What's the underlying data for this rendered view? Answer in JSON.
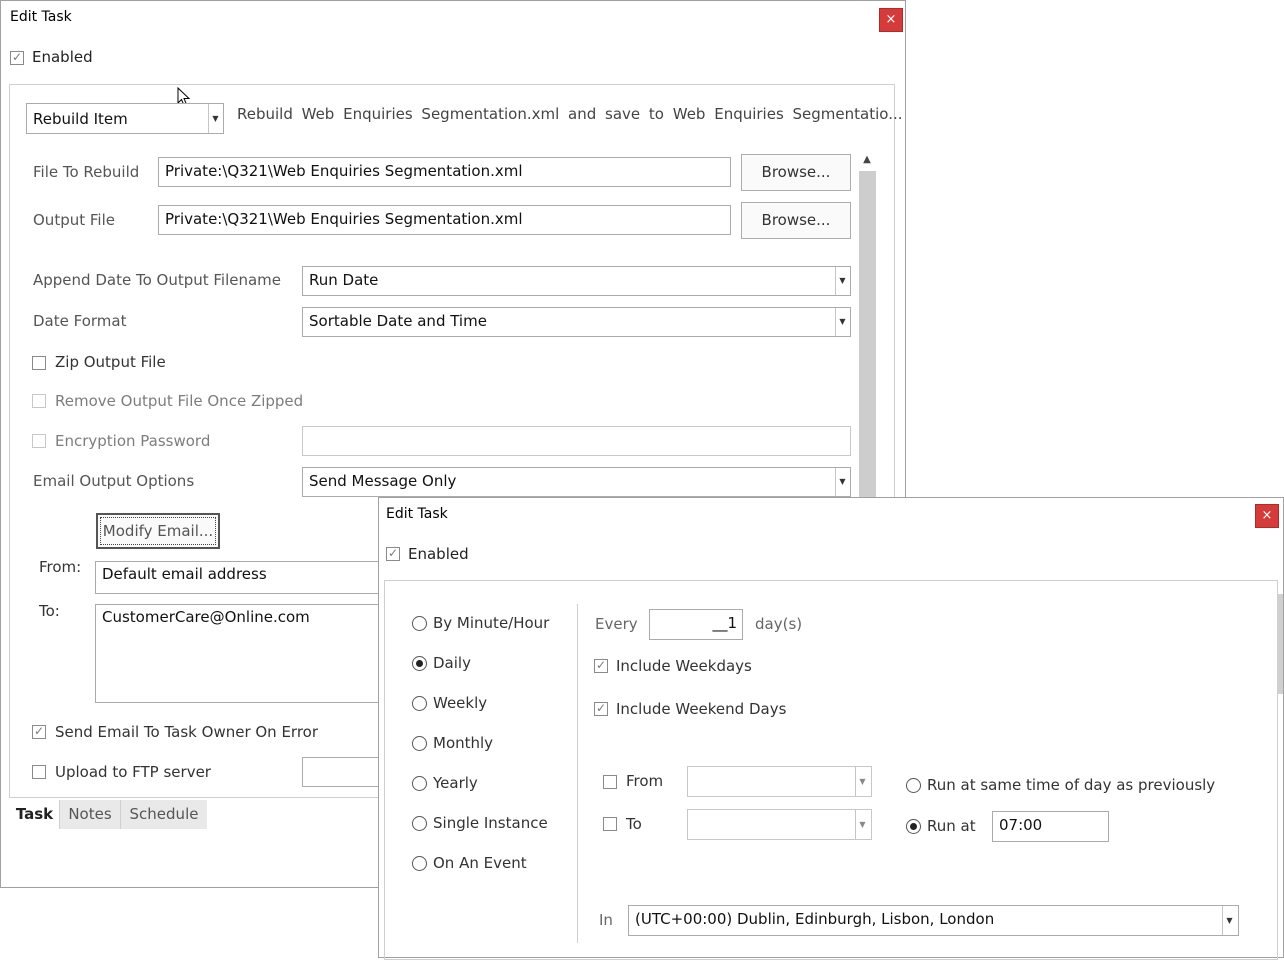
{
  "win1": {
    "title": "Edit Task",
    "close": "×",
    "enabled_label": "Enabled",
    "action_type": "Rebuild Item",
    "action_desc": "Rebuild Web Enquiries Segmentation.xml and save to Web Enquiries Segmentatio...",
    "file_to_rebuild_label": "File To Rebuild",
    "file_to_rebuild": "Private:\\Q321\\Web Enquiries Segmentation.xml",
    "output_file_label": "Output File",
    "output_file": "Private:\\Q321\\Web Enquiries Segmentation.xml",
    "browse": "Browse...",
    "append_date_label": "Append Date To Output Filename",
    "append_date_value": "Run Date",
    "date_format_label": "Date Format",
    "date_format_value": "Sortable Date and Time",
    "zip_label": "Zip Output File",
    "remove_zip_label": "Remove Output File Once Zipped",
    "encryption_label": "Encryption Password",
    "encryption_value": "",
    "email_options_label": "Email Output Options",
    "email_options_value": "Send Message Only",
    "modify_email": "Modify Email...",
    "from_label": "From:",
    "from_value": "Default email address",
    "to_label": "To:",
    "to_value": "CustomerCare@Online.com",
    "send_email_error_label": "Send Email To Task Owner On Error",
    "upload_ftp_label": "Upload to FTP server",
    "tabs": [
      "Task",
      "Notes",
      "Schedule"
    ]
  },
  "win2": {
    "title": "Edit Task",
    "close": "×",
    "enabled_label": "Enabled",
    "frequencies": [
      "By Minute/Hour",
      "Daily",
      "Weekly",
      "Monthly",
      "Yearly",
      "Single Instance",
      "On An Event"
    ],
    "selected_frequency": "Daily",
    "every_label": "Every",
    "every_value": "__1",
    "every_unit": "day(s)",
    "include_weekdays": "Include Weekdays",
    "include_weekend": "Include Weekend Days",
    "from_label": "From",
    "to_label": "To",
    "run_same_time": "Run at same time of day as previously",
    "run_at_label": "Run at",
    "run_at_value": "07:00",
    "in_label": "In",
    "timezone": "(UTC+00:00) Dublin, Edinburgh, Lisbon, London"
  }
}
